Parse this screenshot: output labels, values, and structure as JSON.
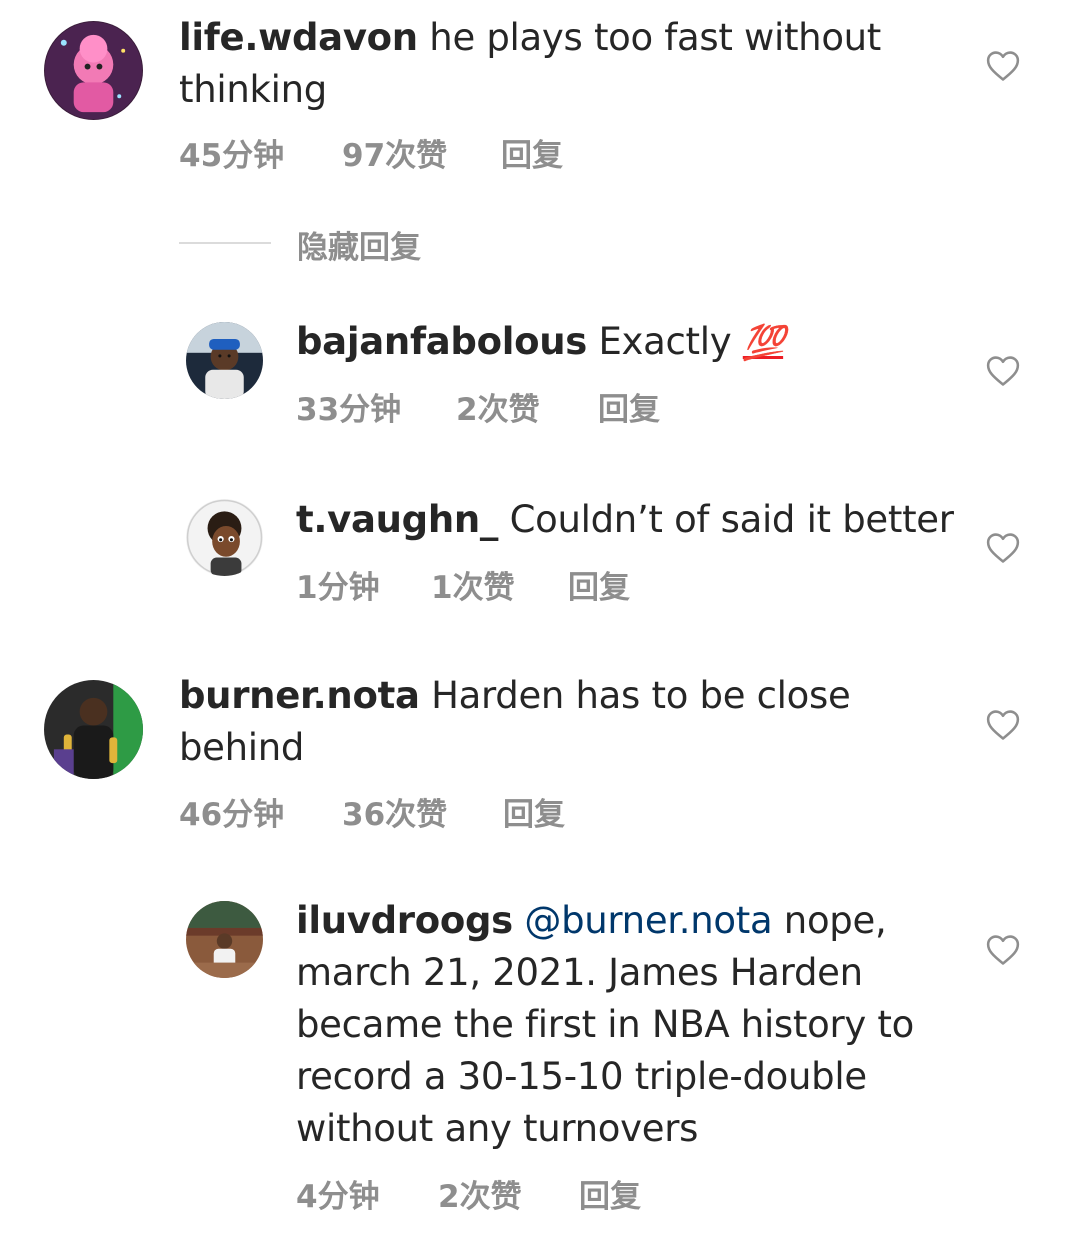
{
  "comments": [
    {
      "username": "life.wdavon",
      "text_line1": " he plays too fast without",
      "text_line2": "thinking",
      "time": "45分钟",
      "likes": "97次赞",
      "reply": "回复"
    },
    {
      "username": "bajanfabolous",
      "text": " Exactly ",
      "emoji": "💯",
      "time": "33分钟",
      "likes": "2次赞",
      "reply": "回复"
    },
    {
      "username": "t.vaughn_",
      "text": " Couldn’t of said it better",
      "time": "1分钟",
      "likes": "1次赞",
      "reply": "回复"
    },
    {
      "username": "burner.nota",
      "text_line1": " Harden has to be close",
      "text_line2": "behind",
      "time": "46分钟",
      "likes": "36次赞",
      "reply": "回复"
    },
    {
      "username": "iluvdroogs",
      "mention": "@burner.nota",
      "text_line1": " nope,",
      "text_line2": "march 21, 2021. James Harden",
      "text_line3": "became the first in NBA history to",
      "text_line4": "record a 30-15-10 triple-double",
      "text_line5": "without any turnovers",
      "time": "4分钟",
      "likes": "2次赞",
      "reply": "回复"
    }
  ],
  "hide_replies_label": "隐藏回复",
  "icons": {
    "like": "heart-outline-icon"
  },
  "colors": {
    "text": "#262626",
    "secondary": "#8e8e8e",
    "mention": "#00376b",
    "emoji": "#ed1c24"
  }
}
